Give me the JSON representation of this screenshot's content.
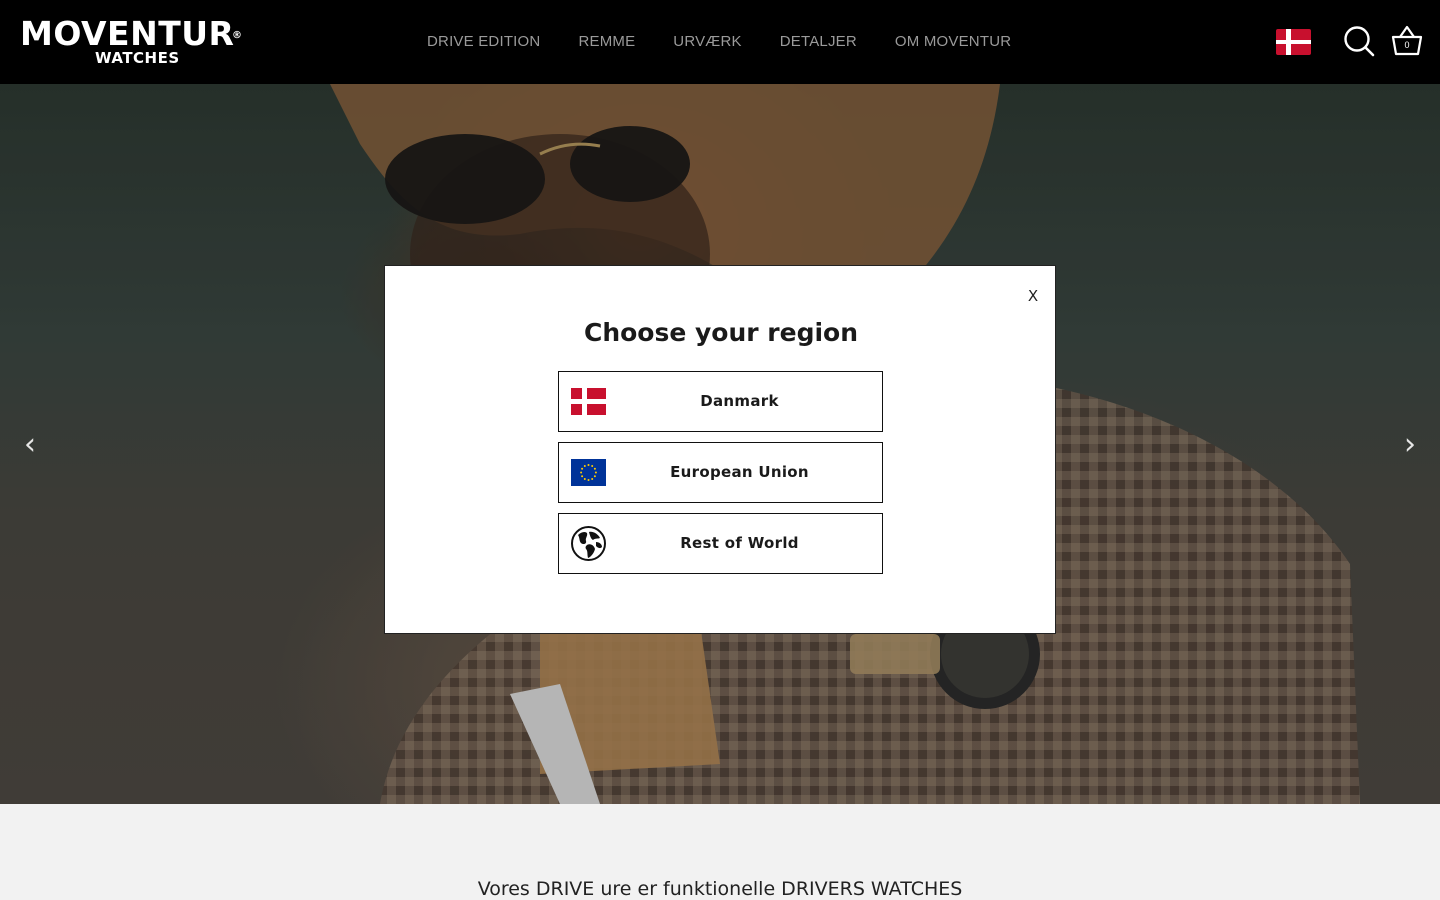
{
  "header": {
    "logo_main": "MOVENTUR",
    "logo_reg": "®",
    "logo_sub": "WATCHES",
    "nav": [
      "DRIVE EDITION",
      "REMME",
      "URVÆRK",
      "DETALJER",
      "OM MOVENTUR"
    ],
    "cart_count": "0"
  },
  "hero": {
    "prev_arrow": "‹",
    "next_arrow": "›"
  },
  "below": {
    "tagline": "Vores DRIVE ure er funktionelle DRIVERS WATCHES"
  },
  "modal": {
    "title": "Choose your region",
    "close_label": "X",
    "regions": [
      {
        "label": "Danmark",
        "icon": "denmark-flag-icon"
      },
      {
        "label": "European Union",
        "icon": "eu-flag-icon"
      },
      {
        "label": "Rest of World",
        "icon": "globe-icon"
      }
    ]
  },
  "colors": {
    "header_bg": "#000000",
    "nav_text": "#9a9a9a",
    "danish_red": "#c8102e",
    "eu_blue": "#003399",
    "eu_star": "#ffcc00",
    "modal_bg": "#ffffff"
  }
}
